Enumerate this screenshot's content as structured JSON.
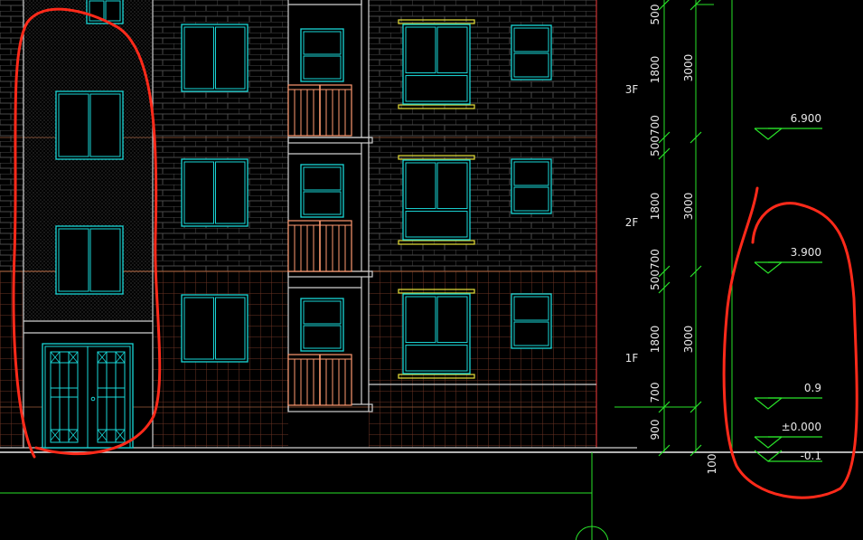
{
  "colors": {
    "background": "#000000",
    "wall_line": "#cfcfcf",
    "window": "#19d7d7",
    "railing": "#ff9a70",
    "sill": "#e8e23a",
    "dimension": "#29e229",
    "tile_grid": "#7a3a2a",
    "markup": "#ff2a1a"
  },
  "floors": [
    {
      "label": "3F"
    },
    {
      "label": "2F"
    },
    {
      "label": "1F"
    }
  ],
  "dimensions": {
    "inner": [
      "500",
      "1800",
      "500700",
      "1800",
      "500700",
      "1800",
      "700",
      "900"
    ],
    "outer": [
      "3000",
      "3000",
      "3000"
    ],
    "bottom": "100"
  },
  "elevations": [
    {
      "value": "6.900"
    },
    {
      "value": "3.900"
    },
    {
      "value": "0.9"
    },
    {
      "value": "±0.000"
    },
    {
      "value": "-0.1"
    }
  ]
}
